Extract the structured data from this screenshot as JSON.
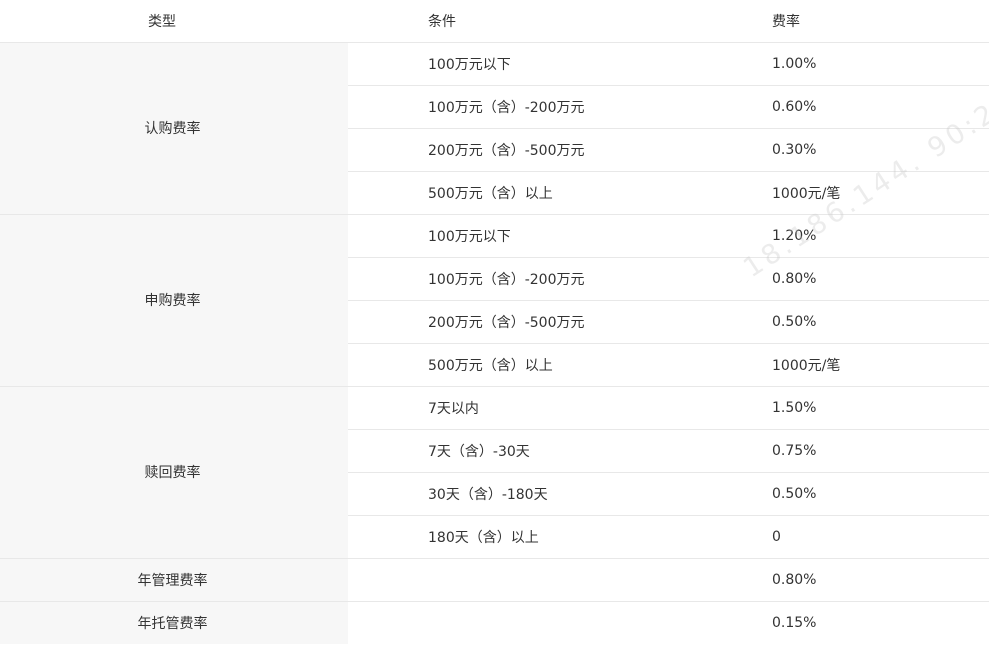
{
  "headers": {
    "type": "类型",
    "condition": "条件",
    "rate": "费率"
  },
  "groups": [
    {
      "type": "认购费率",
      "rows": [
        {
          "condition": "100万元以下",
          "rate": "1.00%"
        },
        {
          "condition": "100万元（含）-200万元",
          "rate": "0.60%"
        },
        {
          "condition": "200万元（含）-500万元",
          "rate": "0.30%"
        },
        {
          "condition": "500万元（含）以上",
          "rate": "1000元/笔"
        }
      ]
    },
    {
      "type": "申购费率",
      "rows": [
        {
          "condition": "100万元以下",
          "rate": "1.20%"
        },
        {
          "condition": "100万元（含）-200万元",
          "rate": "0.80%"
        },
        {
          "condition": "200万元（含）-500万元",
          "rate": "0.50%"
        },
        {
          "condition": "500万元（含）以上",
          "rate": "1000元/笔"
        }
      ]
    },
    {
      "type": "赎回费率",
      "rows": [
        {
          "condition": "7天以内",
          "rate": "1.50%"
        },
        {
          "condition": "7天（含）-30天",
          "rate": "0.75%"
        },
        {
          "condition": "30天（含）-180天",
          "rate": "0.50%"
        },
        {
          "condition": "180天（含）以上",
          "rate": "0"
        }
      ]
    },
    {
      "type": "年管理费率",
      "rows": [
        {
          "condition": "",
          "rate": "0.80%"
        }
      ]
    },
    {
      "type": "年托管费率",
      "rows": [
        {
          "condition": "",
          "rate": "0.15%"
        }
      ]
    }
  ],
  "watermark": "18.186.144. 90:2"
}
